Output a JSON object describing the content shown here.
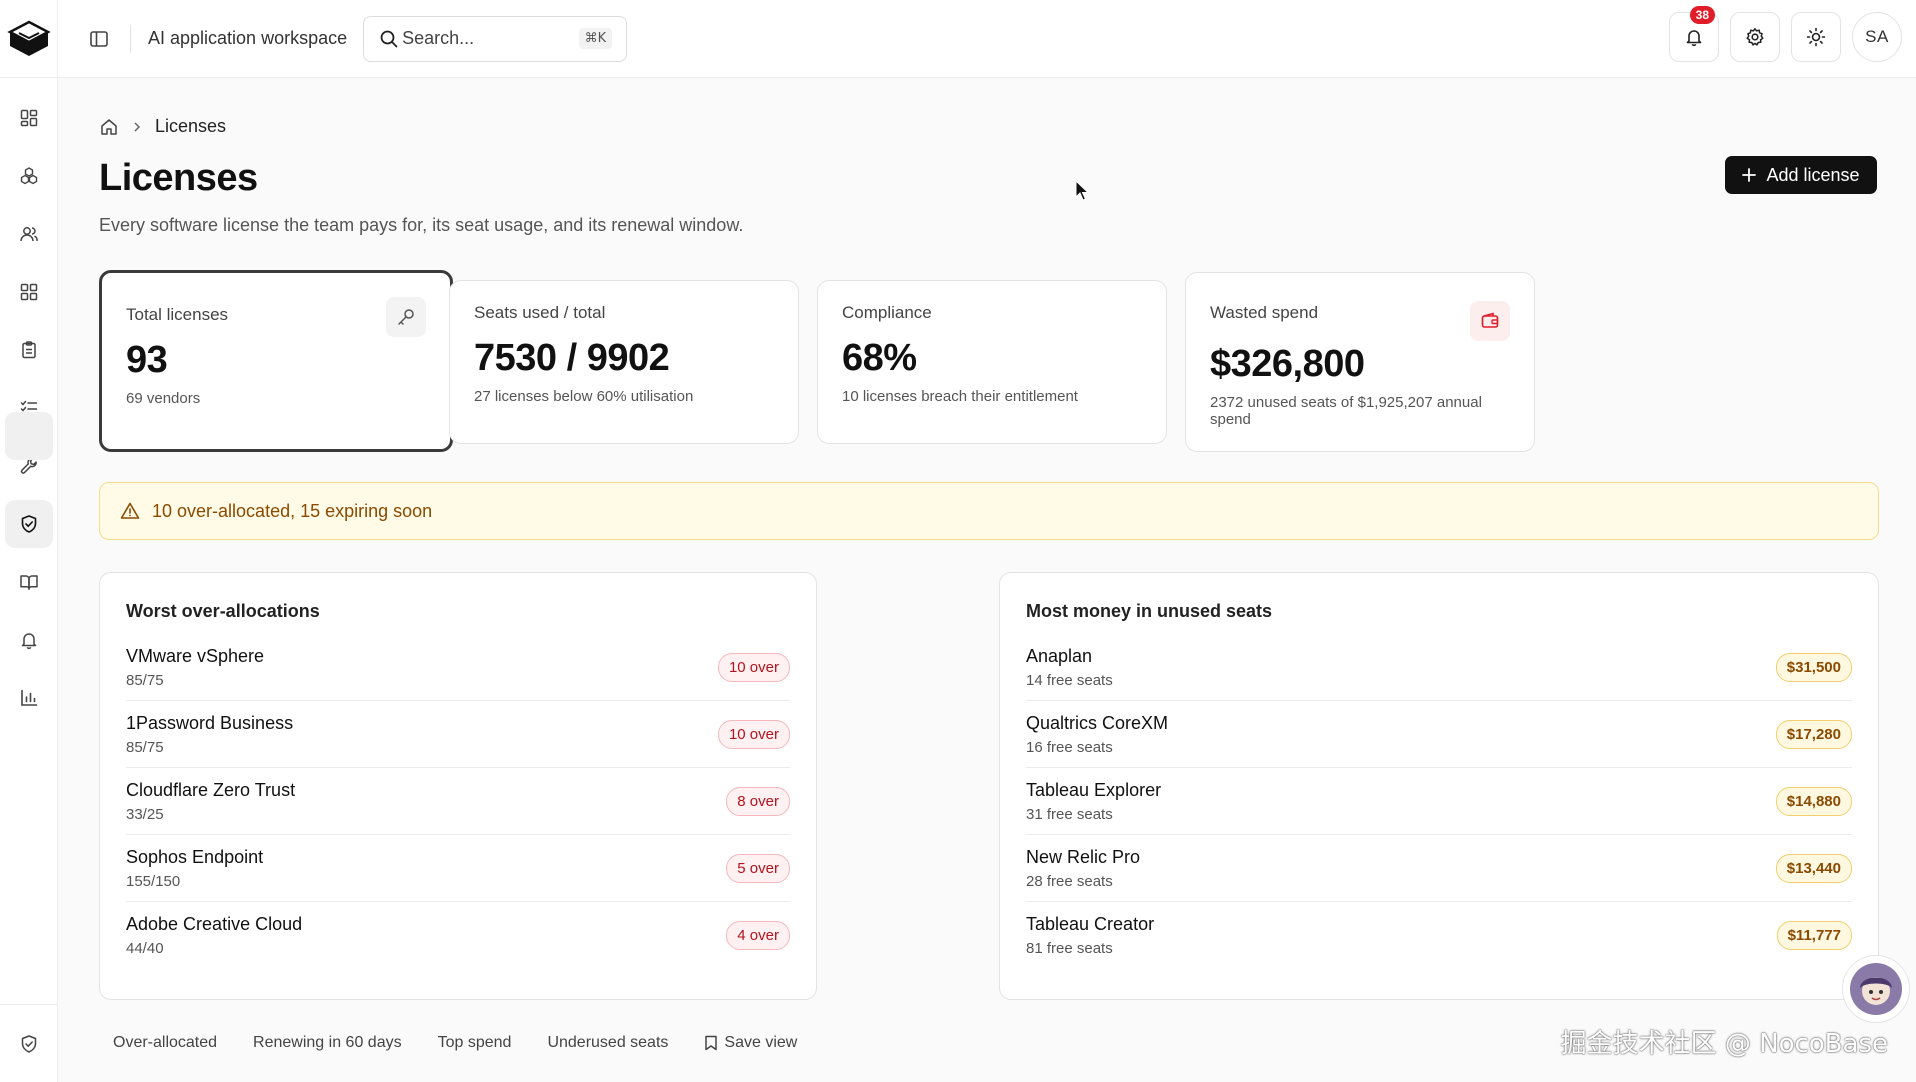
{
  "header": {
    "workspace": "AI application workspace",
    "search_placeholder": "Search...",
    "shortcut": "⌘K",
    "notifications_count": "38",
    "avatar_initials": "SA"
  },
  "breadcrumb": {
    "current": "Licenses"
  },
  "page": {
    "title": "Licenses",
    "description": "Every software license the team pays for, its seat usage, and its renewal window.",
    "add_button": "Add license"
  },
  "stats": [
    {
      "label": "Total licenses",
      "value": "93",
      "sub": "69 vendors"
    },
    {
      "label": "Seats used / total",
      "value": "7530 / 9902",
      "sub": "27 licenses below 60% utilisation"
    },
    {
      "label": "Compliance",
      "value": "68%",
      "sub": "10 licenses breach their entitlement"
    },
    {
      "label": "Wasted spend",
      "value": "$326,800",
      "sub": "2372 unused seats of $1,925,207 annual spend"
    }
  ],
  "alert": {
    "text": "10 over-allocated, 15 expiring soon"
  },
  "over_allocations": {
    "title": "Worst over-allocations",
    "items": [
      {
        "name": "VMware vSphere",
        "usage": "85/75",
        "badge": "10 over"
      },
      {
        "name": "1Password Business",
        "usage": "85/75",
        "badge": "10 over"
      },
      {
        "name": "Cloudflare Zero Trust",
        "usage": "33/25",
        "badge": "8 over"
      },
      {
        "name": "Sophos Endpoint",
        "usage": "155/150",
        "badge": "5 over"
      },
      {
        "name": "Adobe Creative Cloud",
        "usage": "44/40",
        "badge": "4 over"
      }
    ]
  },
  "unused_seats": {
    "title": "Most money in unused seats",
    "items": [
      {
        "name": "Anaplan",
        "free": "14 free seats",
        "badge": "$31,500"
      },
      {
        "name": "Qualtrics CoreXM",
        "free": "16 free seats",
        "badge": "$17,280"
      },
      {
        "name": "Tableau Explorer",
        "free": "31 free seats",
        "badge": "$14,880"
      },
      {
        "name": "New Relic Pro",
        "free": "28 free seats",
        "badge": "$13,440"
      },
      {
        "name": "Tableau Creator",
        "free": "81 free seats",
        "badge": "$11,777"
      }
    ]
  },
  "tabs": [
    "Over-allocated",
    "Renewing in 60 days",
    "Top spend",
    "Underused seats"
  ],
  "save_view": "Save view",
  "watermark": "掘金技术社区 @ NocoBase",
  "colors": {
    "badge_red": "#e11d2a",
    "alert_bg": "#fffbe6",
    "amber": "#8a4a00",
    "danger_text": "#b3121e"
  }
}
